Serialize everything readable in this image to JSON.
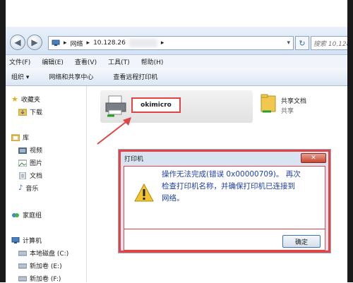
{
  "address_bar": {
    "crumbs": [
      "网络",
      "10.128.26"
    ],
    "search_placeholder": "搜索 10.128.26"
  },
  "menu": [
    "文件(F)",
    "编辑(E)",
    "查看(V)",
    "工具(T)",
    "帮助(H)"
  ],
  "toolbar": {
    "organize": "组织 ▾",
    "network_center": "网络和共享中心",
    "view_printers": "查看远程打印机"
  },
  "sidebar": {
    "favorites": "收藏夹",
    "downloads": "下载",
    "library": "库",
    "videos": "视频",
    "pictures": "图片",
    "documents": "文档",
    "music": "音乐",
    "homegroup": "家庭组",
    "computer": "计算机",
    "drives": [
      "本地磁盘 (C:)",
      "新加卷 (E:)",
      "新加卷 (F:)"
    ]
  },
  "items": {
    "printer_name": "okimicro",
    "share_name": "共享文档",
    "share_sub": "共享"
  },
  "dialog": {
    "title": "打印机",
    "close": "✕",
    "line1": "操作无法完成(错误 0x00000709)。 再次",
    "line2": "检查打印机名称，并确保打印机已连接到",
    "line3": "网络。",
    "ok": "确定"
  },
  "colors": {
    "highlight_red": "#e04444",
    "message_blue": "#2040a8"
  }
}
